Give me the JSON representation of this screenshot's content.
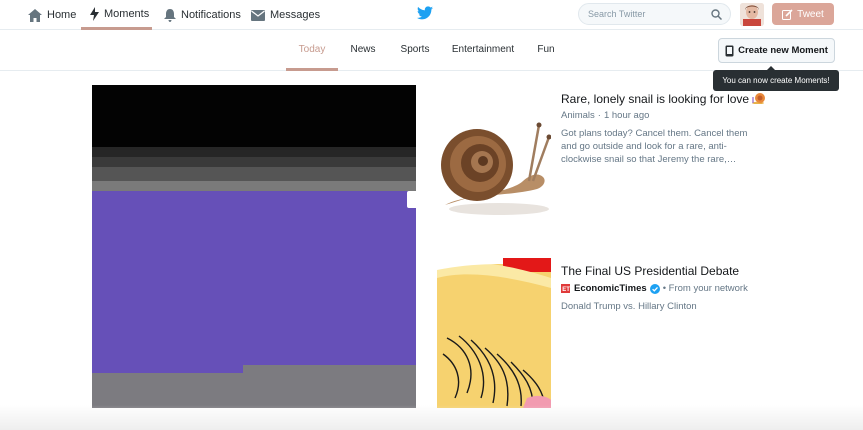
{
  "nav": {
    "home": "Home",
    "moments": "Moments",
    "notifications": "Notifications",
    "messages": "Messages"
  },
  "search": {
    "placeholder": "Search Twitter"
  },
  "tweet_label": "Tweet",
  "tabs": [
    "Today",
    "News",
    "Sports",
    "Entertainment",
    "Fun"
  ],
  "active_tab": "Today",
  "create_moment_label": "Create new Moment",
  "tooltip": "You can now create Moments!",
  "moments": [
    {
      "title": "Rare, lonely snail is looking for love",
      "category": "Animals",
      "time": "1 hour ago",
      "description": "Got plans today? Cancel them. Cancel them and go outside and look for a rare, anti-clockwise snail so that Jeremy the rare,…"
    },
    {
      "title": "The Final US Presidential Debate",
      "source": "EconomicTimes",
      "context": "• From your network",
      "description": "Donald Trump vs. Hillary Clinton"
    }
  ],
  "colors": {
    "accent": "#c79b8f",
    "twitter_blue": "#1da1f2",
    "tweet_button": "#dba699",
    "hero_purple": "#6650b8"
  },
  "icons": [
    "home-icon",
    "lightning-icon",
    "bell-icon",
    "envelope-icon",
    "twitter-bird-icon",
    "search-icon",
    "compose-icon",
    "phone-icon",
    "verified-icon"
  ]
}
